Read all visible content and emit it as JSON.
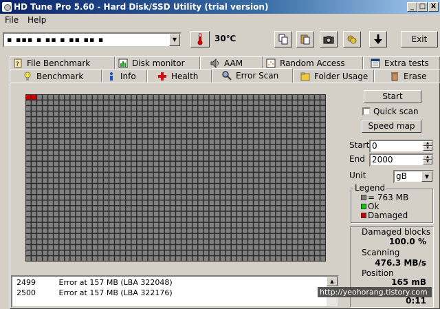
{
  "window": {
    "title": "HD Tune Pro 5.60 - Hard Disk/SSD Utility (trial version)",
    "buttons": [
      "_",
      "□",
      "X"
    ]
  },
  "menu": [
    {
      "label": "File"
    },
    {
      "label": "Help"
    }
  ],
  "toolbar": {
    "drive_value": "▪ ▪▪▪ ▪ ▪▪ ▪ ▪▪ ▪▪ ▪",
    "temperature": "30℃",
    "exit_label": "Exit",
    "icons": [
      "copy-icon",
      "paste-icon",
      "camera-icon",
      "options-icon",
      "download-icon"
    ]
  },
  "tabs_top": [
    {
      "label": "File Benchmark",
      "icon": "file-benchmark-icon"
    },
    {
      "label": "Disk monitor",
      "icon": "disk-monitor-icon"
    },
    {
      "label": "AAM",
      "icon": "speaker-icon"
    },
    {
      "label": "Random Access",
      "icon": "random-access-icon"
    },
    {
      "label": "Extra tests",
      "icon": "extra-tests-icon"
    }
  ],
  "tabs_bottom": [
    {
      "label": "Benchmark",
      "icon": "lightbulb-icon"
    },
    {
      "label": "Info",
      "icon": "info-icon"
    },
    {
      "label": "Health",
      "icon": "health-icon"
    },
    {
      "label": "Error Scan",
      "icon": "magnifier-icon",
      "active": true
    },
    {
      "label": "Folder Usage",
      "icon": "folder-icon"
    },
    {
      "label": "Erase",
      "icon": "trash-icon"
    }
  ],
  "scan": {
    "start_button": "Start",
    "quick_scan_label": "Quick scan",
    "quick_scan_checked": false,
    "speed_map_button": "Speed map",
    "start_label": "Start",
    "start_value": "0",
    "end_label": "End",
    "end_value": "2000",
    "unit_label": "Unit",
    "unit_value": "gB",
    "damaged_blocks_count": 2,
    "ok_color": "#808080",
    "damaged_color": "#cc0000"
  },
  "legend": {
    "title": "Legend",
    "block_size": "= 763 MB",
    "ok": "Ok",
    "damaged": "Damaged",
    "colors": {
      "block": "#808080",
      "ok": "#00cc00",
      "damaged": "#cc0000"
    }
  },
  "stats": {
    "damaged_blocks_label": "Damaged blocks",
    "damaged_blocks_value": "100.0 %",
    "scanning_label": "Scanning",
    "scanning_value": "476.3 MB/s",
    "position_label": "Position",
    "position_value": "165 mB",
    "elapsed_value": "0:11"
  },
  "log": [
    {
      "id": "2499",
      "message": "Error at 157 MB (LBA 322048)"
    },
    {
      "id": "2500",
      "message": "Error at 157 MB (LBA 322176)"
    }
  ],
  "watermark": "http://yeohorang.tistory.com"
}
